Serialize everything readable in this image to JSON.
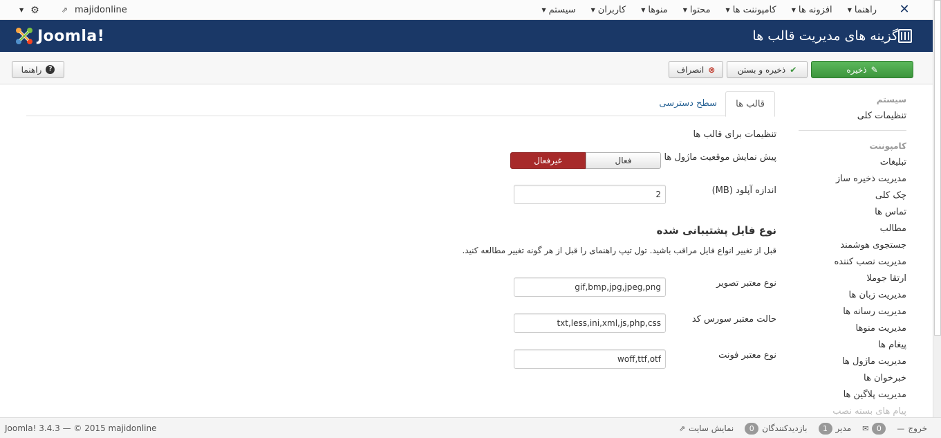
{
  "topbar": {
    "menu": [
      {
        "label": "سیستم"
      },
      {
        "label": "کاربران"
      },
      {
        "label": "منوها"
      },
      {
        "label": "محتوا"
      },
      {
        "label": "کامپوننت ها"
      },
      {
        "label": "افزونه ها"
      },
      {
        "label": "راهنما"
      }
    ],
    "site_name": "majidonline"
  },
  "header": {
    "logo_text": "Joomla!",
    "page_title": "گزینه های مدیریت قالب ها"
  },
  "toolbar": {
    "save": "ذخیره",
    "save_close": "ذخیره و بستن",
    "cancel": "انصراف",
    "help": "راهنما"
  },
  "sidebar": {
    "system_heading": "سیستم",
    "global_config": "تنظیمات کلی",
    "component_heading": "کامپوننت",
    "items": [
      "تبلیغات",
      "مدیریت ذخیره ساز",
      "چک کلی",
      "تماس ها",
      "مطالب",
      "جستجوی هوشمند",
      "مدیریت نصب کننده",
      "ارتقا جوملا",
      "مدیریت زبان ها",
      "مدیریت رسانه ها",
      "مدیریت منوها",
      "پیغام ها",
      "مدیریت ماژول ها",
      "خبرخوان ها",
      "مدیریت پلاگین ها"
    ],
    "faded_item": "پیام های بسته نصب"
  },
  "tabs": {
    "templates": "قالب ها",
    "permissions": "سطح دسترسی"
  },
  "form": {
    "section_label": "تنظیمات برای قالب ها",
    "preview_label": "پیش نمایش موقعیت ماژول ها",
    "toggle_on": "فعال",
    "toggle_off": "غیرفعال",
    "toggle_selected": "غیرفعال",
    "upload_label": "اندازه آپلود (MB)",
    "upload_value": "2",
    "filetypes_heading": "نوع فایل پشتیبانی شده",
    "filetypes_note": "قبل از تغییر انواع فایل مراقب باشید. تول تیپ راهنمای را قبل از هر گونه تغییر مطالعه کنید.",
    "image_label": "نوع معتبر تصویر",
    "image_value": "gif,bmp,jpg,jpeg,png",
    "source_label": "حالت معتبر سورس کد",
    "source_value": "txt,less,ini,xml,js,php,css",
    "font_label": "نوع معتبر فونت",
    "font_value": "woff,ttf,otf"
  },
  "statusbar": {
    "copyright": "Joomla! 3.4.3  —  © 2015 majidonline",
    "view_site": "نمایش سایت",
    "visitors_count": "0",
    "visitors_label": "بازدیدکنندگان",
    "admins_count": "1",
    "admins_label": "مدیر",
    "messages_count": "0",
    "logout": "خروج"
  },
  "colors": {
    "header_bg": "#1a3867",
    "save_green": "#46a546",
    "toggle_off_red": "#a72a2a",
    "link_blue": "#2a6496"
  }
}
